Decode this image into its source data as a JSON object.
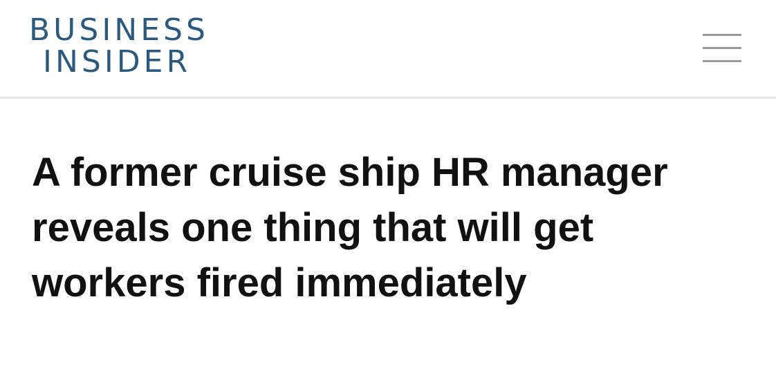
{
  "header": {
    "logo_line1": "BUSINESS",
    "logo_line2": "INSIDER",
    "menu_icon": "hamburger-menu-icon",
    "brand_color": "#2d5a7b"
  },
  "article": {
    "headline": "A former cruise ship HR manager reveals one thing that will get workers fired immediately"
  }
}
